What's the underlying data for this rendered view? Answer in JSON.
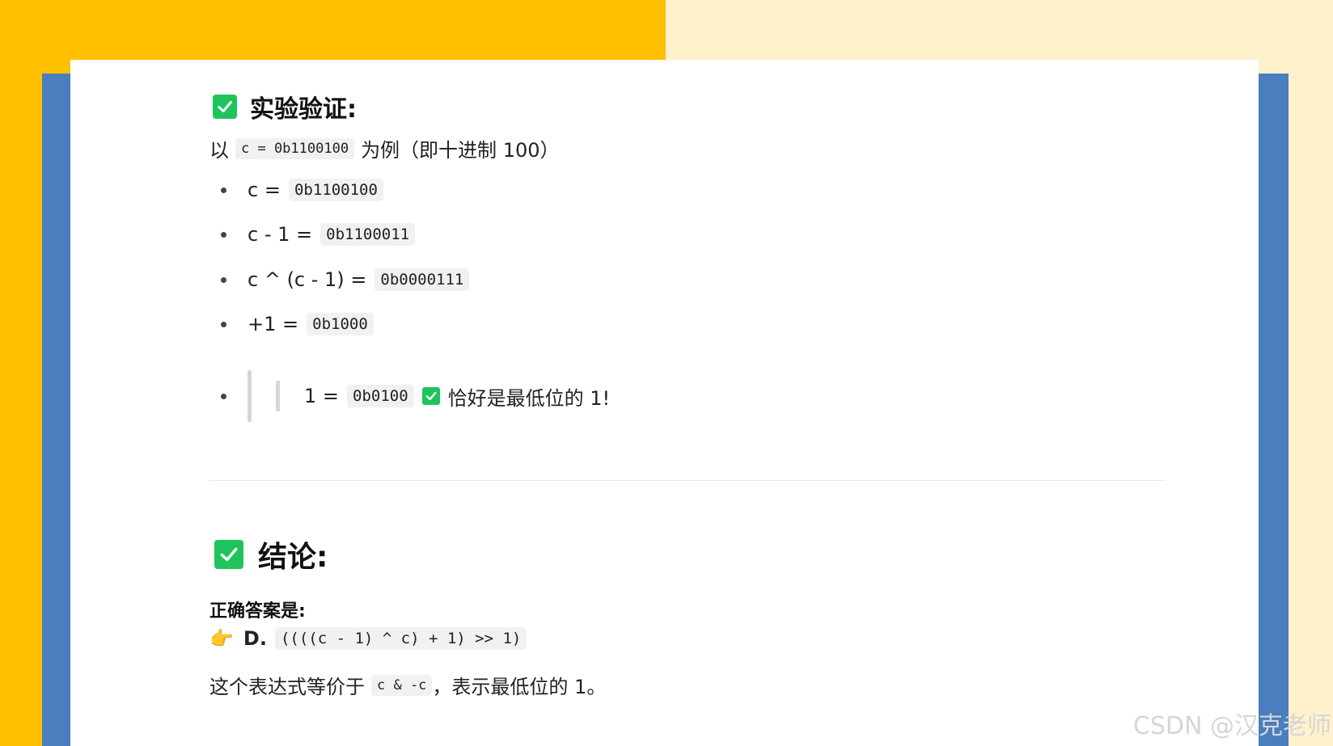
{
  "section1": {
    "title": "实验验证:",
    "intro_prefix": "以",
    "intro_code": "c = 0b1100100",
    "intro_suffix": "为例（即十进制 100）",
    "items": [
      {
        "label": "c =",
        "code": "0b1100100"
      },
      {
        "label": "c - 1 =",
        "code": "0b1100011"
      },
      {
        "label": "c ^ (c - 1) =",
        "code": "0b0000111"
      },
      {
        "label": "+1 =",
        "code": "0b1000"
      },
      {
        "label": "1 =",
        "code": "0b0100",
        "note": "恰好是最低位的 1!"
      }
    ]
  },
  "section2": {
    "title": "结论:",
    "answer_label": "正确答案是:",
    "answer_option": "D.",
    "answer_code": "((((c - 1) ^ c) + 1) >> 1)",
    "equiv_prefix": "这个表达式等价于",
    "equiv_code": "c & -c",
    "equiv_suffix": "，表示最低位的 1。"
  },
  "watermark": "CSDN @汉克老师",
  "colors": {
    "accent_check": "#1fc35c",
    "bg_yellow": "#ffc000",
    "bg_blue": "#4a7ebe",
    "bg_cream": "#fff1cc"
  }
}
